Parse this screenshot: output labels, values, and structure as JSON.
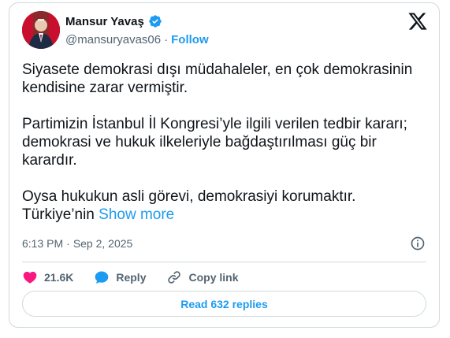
{
  "author": {
    "name": "Mansur Yavaş",
    "handle": "@mansuryavas06",
    "separator": "·",
    "follow_label": "Follow"
  },
  "tweet": {
    "paragraphs": [
      "Siyasete demokrasi dışı müdahaleler, en çok demokrasinin kendisine zarar vermiştir.",
      "Partimizin İstanbul İl Kongresi’yle ilgili verilen tedbir kararı; demokrasi ve hukuk ilkeleriyle bağdaştırılması güç bir karardır.",
      "Oysa hukukun asli görevi, demokrasiyi korumaktır. Türkiye’nin"
    ],
    "show_more": "Show more"
  },
  "meta": {
    "time": "6:13 PM",
    "separator": "·",
    "date": "Sep 2, 2025"
  },
  "actions": {
    "likes": "21.6K",
    "reply_label": "Reply",
    "copy_link_label": "Copy link"
  },
  "replies_button": "Read 632 replies",
  "colors": {
    "accent": "#1d9bf0",
    "like": "#f91880",
    "text": "#0f1419",
    "muted": "#536471"
  },
  "icons": [
    "verified-badge-icon",
    "x-logo-icon",
    "info-icon",
    "heart-icon",
    "reply-icon",
    "link-icon"
  ]
}
